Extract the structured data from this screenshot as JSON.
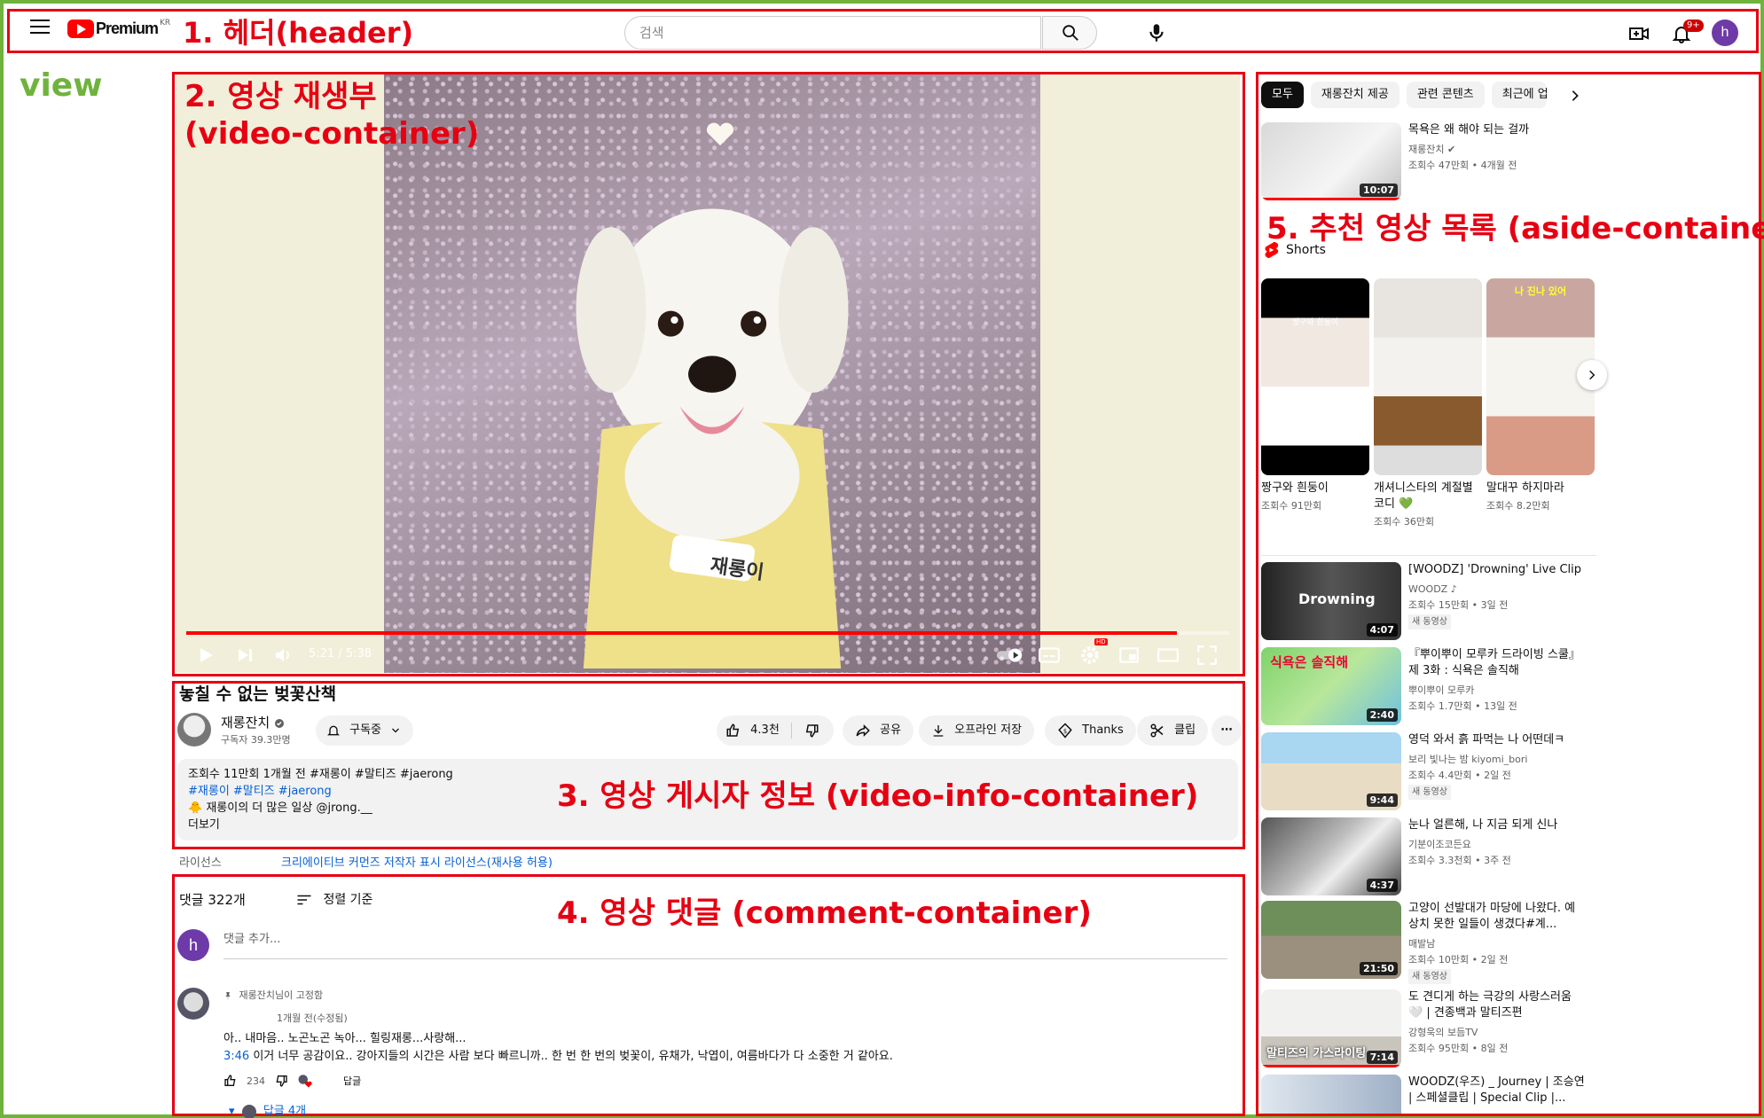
{
  "annotations": {
    "view": "view",
    "header": "1. 헤더(header)",
    "video": "2. 영상 재생부\n(video-container)",
    "info": "3. 영상 게시자 정보 (video-info-container)",
    "comment": "4. 영상 댓글 (comment-container)",
    "aside": "5. 추천 영상 목록 (aside-container)"
  },
  "header": {
    "logo_text": "Premium",
    "logo_region": "KR",
    "search_placeholder": "검색",
    "notification_count": "9+",
    "avatar_letter": "h"
  },
  "player": {
    "time": "5:21 / 5:38",
    "progress": 0.95,
    "name_tag": "재롱이",
    "hd_badge": "HD"
  },
  "video_info": {
    "title": "놓칠 수 없는 벚꽃산책",
    "channel": "재롱잔치",
    "subscribers": "구독자 39.3만명",
    "subscribe_label": "구독중",
    "likes": "4.3천",
    "share": "공유",
    "download": "오프라인 저장",
    "thanks": "Thanks",
    "clip": "클립",
    "desc_meta": "조회수 11만회  1개월 전  #재롱이 #말티즈 #jaerong",
    "desc_tags": "#재롱이 #말티즈 #jaerong",
    "desc_line": "🐥 재롱이의 더 많은 일상 @jrong.__",
    "more": "더보기",
    "license_label": "라이선스",
    "license_value": "크리에이티브 커먼즈 저작자 표시 라이선스(재사용 허용)"
  },
  "comments": {
    "count": "댓글 322개",
    "sort": "정렬 기준",
    "input_placeholder": "댓글 추가...",
    "avatar_letter": "h",
    "pinned": "재롱잔치님이 고정함",
    "time": "1개월 전(수정됨)",
    "line1": "아.. 내마음.. 노곤노곤 녹아... 힐링재롱...사랑해...",
    "timestamp": "3:46",
    "line2": " 이거 너무 공감이요.. 강아지들의 시간은 사람 보다 빠르니까.. 한 번 한 번의 벚꽃이, 유채가, 낙엽이, 여름바다가 다 소중한 거 같아요.",
    "likes": "234",
    "reply": "답글",
    "replies": "답글 4개"
  },
  "aside": {
    "chips": [
      "모두",
      "재롱잔치 제공",
      "관련 콘텐츠",
      "최근에 업"
    ],
    "first": {
      "title": "목욕은 왜 해야 되는 걸까",
      "channel": "재롱잔치",
      "meta": "조회수 47만회 • 4개월 전",
      "duration": "10:07"
    },
    "shorts_label": "Shorts",
    "shorts": [
      {
        "title": "짱구와 흰둥이",
        "views": "조회수 91만회",
        "overlay": "짱구와 흰둥이"
      },
      {
        "title": "개셔니스타의 계절별 코디 💚",
        "views": "조회수 36만회",
        "overlay": ""
      },
      {
        "title": "말대꾸 하지마라",
        "views": "조회수 8.2만회",
        "overlay": "나 진나 있어"
      }
    ],
    "videos": [
      {
        "title": "[WOODZ] 'Drowning' Live Clip",
        "channel": "WOODZ ♪",
        "meta": "조회수 15만회 • 3일 전",
        "tag": "새 동영상",
        "duration": "4:07",
        "overlay": "Drowning"
      },
      {
        "title": "『뿌이뿌이 모루카 드라이빙 스쿨』제 3화 : 식욕은 솔직해",
        "channel": "뿌이뿌이 모루카",
        "meta": "조회수 1.7만회 • 13일 전",
        "tag": "",
        "duration": "2:40",
        "overlay": "식욕은 솔직해"
      },
      {
        "title": "영덕 와서 흙 파먹는 나 어떤데ㅋ",
        "channel": "보리 빛나는 밤 kiyomi_bori",
        "meta": "조회수 4.4만회 • 2일 전",
        "tag": "새 동영상",
        "duration": "9:44",
        "overlay": ""
      },
      {
        "title": "눈나 얼른해, 나 지금 되게 신나",
        "channel": "기분이조코든요",
        "meta": "조회수 3.3천회 • 3주 전",
        "tag": "",
        "duration": "4:37",
        "overlay": ""
      },
      {
        "title": "고양이 선발대가 마당에 나왔다. 예상치 못한 일들이 생겼다#계...",
        "channel": "매발남",
        "meta": "조회수 10만회 • 2일 전",
        "tag": "새 동영상",
        "duration": "21:50",
        "overlay": ""
      },
      {
        "title": "도 견디게 하는 극강의 사랑스러움 🤍 | 견종백과 말티즈편",
        "channel": "강형욱의 보듬TV",
        "meta": "조회수 95만회 • 8일 전",
        "tag": "",
        "duration": "7:14",
        "overlay": "말티즈의 가스라이팅"
      },
      {
        "title": "WOODZ(우즈) _ Journey | 조승연 | 스페셜클립 | Special Clip |...",
        "channel": "",
        "meta": "",
        "tag": "",
        "duration": "",
        "overlay": ""
      }
    ]
  },
  "colors": {
    "brand_red": "#ff0000",
    "annotation_red": "#e60012",
    "view_green": "#6fb33d",
    "link_blue": "#065fd4"
  }
}
